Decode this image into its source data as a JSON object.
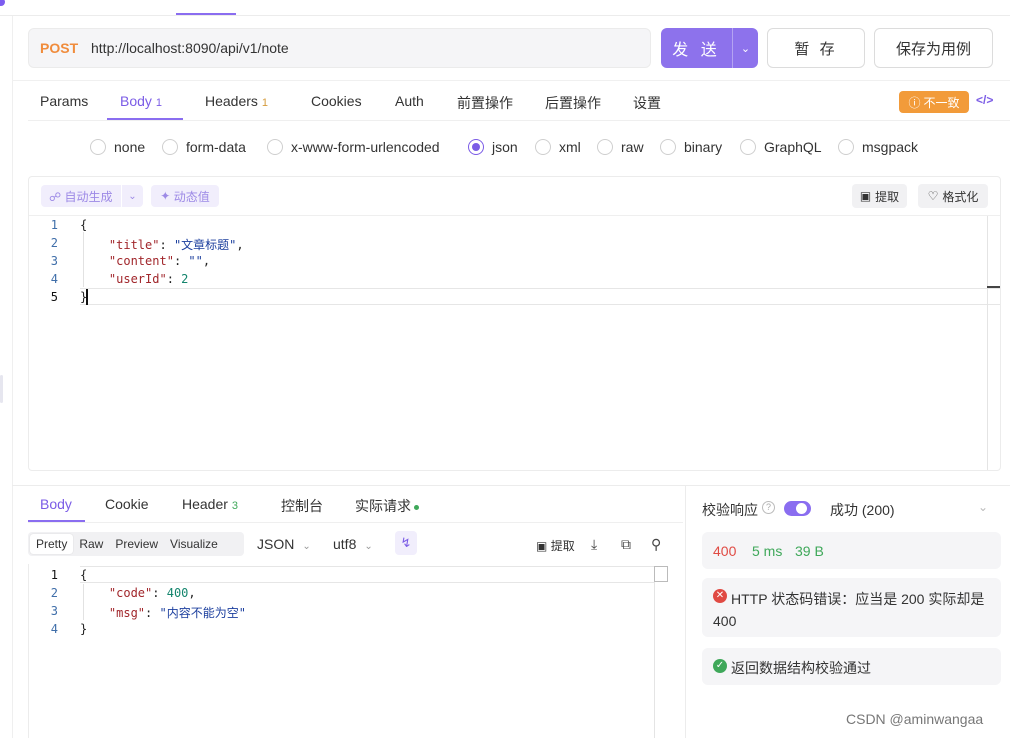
{
  "request": {
    "method": "POST",
    "url": "http://localhost:8090/api/v1/note",
    "send_label": "发 送",
    "stash_label": "暂 存",
    "save_case_label": "保存为用例"
  },
  "request_tabs": [
    {
      "label": "Params"
    },
    {
      "label": "Body",
      "badge": "1"
    },
    {
      "label": "Headers",
      "badge": "1"
    },
    {
      "label": "Cookies"
    },
    {
      "label": "Auth"
    },
    {
      "label": "前置操作"
    },
    {
      "label": "后置操作"
    },
    {
      "label": "设置"
    }
  ],
  "mismatch_badge": "不一致",
  "body_types": [
    "none",
    "form-data",
    "x-www-form-urlencoded",
    "json",
    "xml",
    "raw",
    "binary",
    "GraphQL",
    "msgpack"
  ],
  "selected_body_type": "json",
  "editor": {
    "auto_generate": "自动生成",
    "dynamic_value": "动态值",
    "extract": "提取",
    "format": "格式化",
    "line_numbers": [
      "1",
      "2",
      "3",
      "4",
      "5"
    ],
    "lines": [
      "{",
      "\"title\"",
      ": ",
      "\"文章标题\"",
      ",",
      "\"content\"",
      ": ",
      "\"\"",
      ",",
      "\"userId\"",
      ": ",
      "2",
      "}"
    ]
  },
  "response_tabs": [
    {
      "label": "Body"
    },
    {
      "label": "Cookie"
    },
    {
      "label": "Header",
      "badge": "3"
    },
    {
      "label": "控制台"
    },
    {
      "label": "实际请求"
    }
  ],
  "response_view": {
    "modes": [
      "Pretty",
      "Raw",
      "Preview",
      "Visualize"
    ],
    "format": "JSON",
    "encoding": "utf8",
    "extract": "提取"
  },
  "response_body": {
    "line_numbers": [
      "1",
      "2",
      "3",
      "4"
    ],
    "lines": [
      "{",
      "\"code\"",
      ": ",
      "400",
      ",",
      "\"msg\"",
      ": ",
      "\"内容不能为空\"",
      "}"
    ]
  },
  "validation": {
    "label": "校验响应",
    "result": "成功 (200)",
    "status": "400",
    "time": "5 ms",
    "size": "39 B",
    "error": "HTTP 状态码错误：应当是 200 实际却是 400",
    "pass": "返回数据结构校验通过"
  },
  "watermark": "CSDN @aminwangaa",
  "colors": {
    "accent": "#8a6df0",
    "method": "#f08c3c",
    "error": "#e04a43",
    "success": "#3fa85a",
    "warning": "#f29b3a"
  }
}
